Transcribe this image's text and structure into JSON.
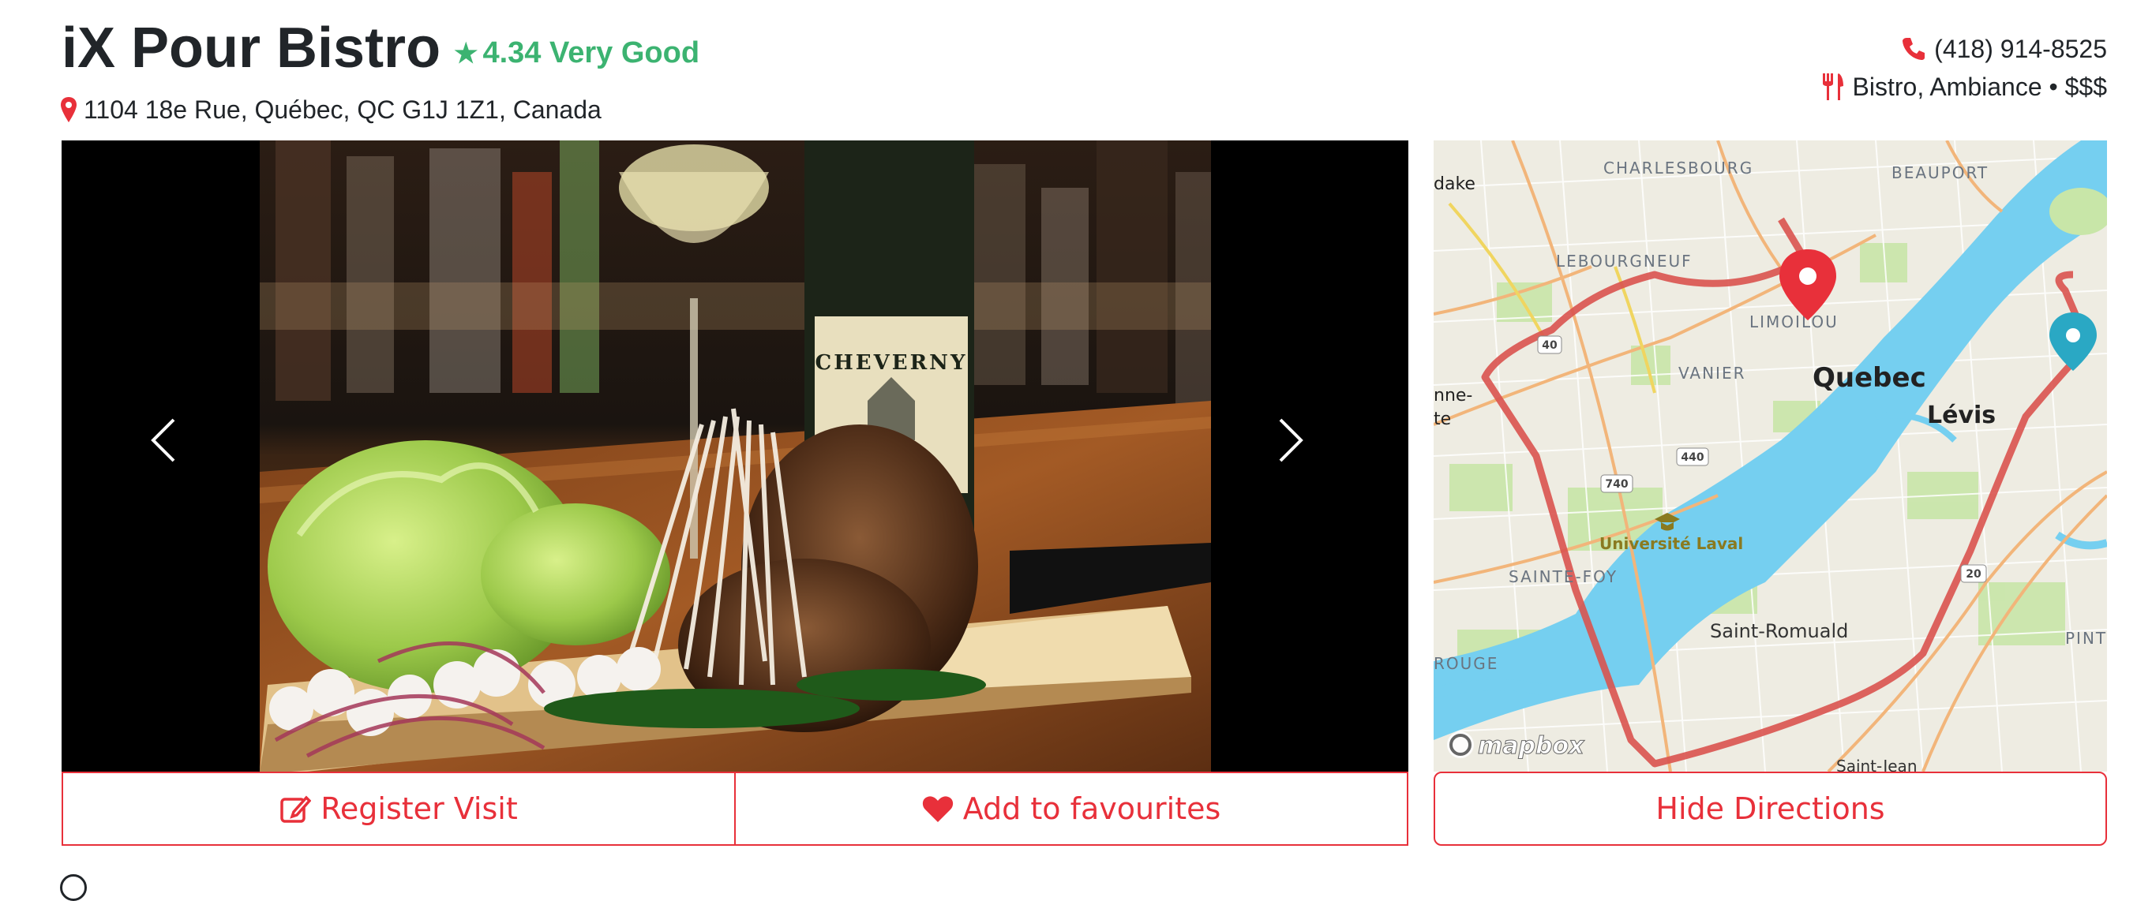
{
  "restaurant": {
    "name": "iX Pour Bistro",
    "rating_value": "4.34",
    "rating_label": "Very Good",
    "address": "1104 18e Rue, Québec, QC G1J 1Z1, Canada",
    "phone": "(418) 914-8525",
    "categories": "Bistro, Ambiance • $$$"
  },
  "actions": {
    "register_visit": "Register Visit",
    "add_favourites": "Add to favourites",
    "hide_directions": "Hide Directions"
  },
  "photo": {
    "bottle_label": "CHEVERNY"
  },
  "map": {
    "labels": {
      "charlesbourg": "CHARLESBOURG",
      "beauport": "BEAUPORT",
      "lebourgneuf": "LEBOURGNEUF",
      "limoilou": "LIMOILOU",
      "vanier": "VANIER",
      "quebec": "Quebec",
      "levis": "Lévis",
      "universite": "Université Laval",
      "sainte_foy": "SAINTE-FOY",
      "saint_romuald": "Saint-Romuald",
      "rouge": "ROUGE",
      "dake": "dake",
      "nne": "nne-",
      "te": "te",
      "pint": "PINT",
      "saint_jean": "Saint-Jean"
    },
    "shields": [
      "40",
      "440",
      "740",
      "20"
    ],
    "attribution": "mapbox"
  },
  "colors": {
    "accent": "#e8303a",
    "rating": "#3cb371",
    "water": "#75cff0",
    "route": "#d9534f",
    "destination_pin": "#2aa8c4"
  }
}
